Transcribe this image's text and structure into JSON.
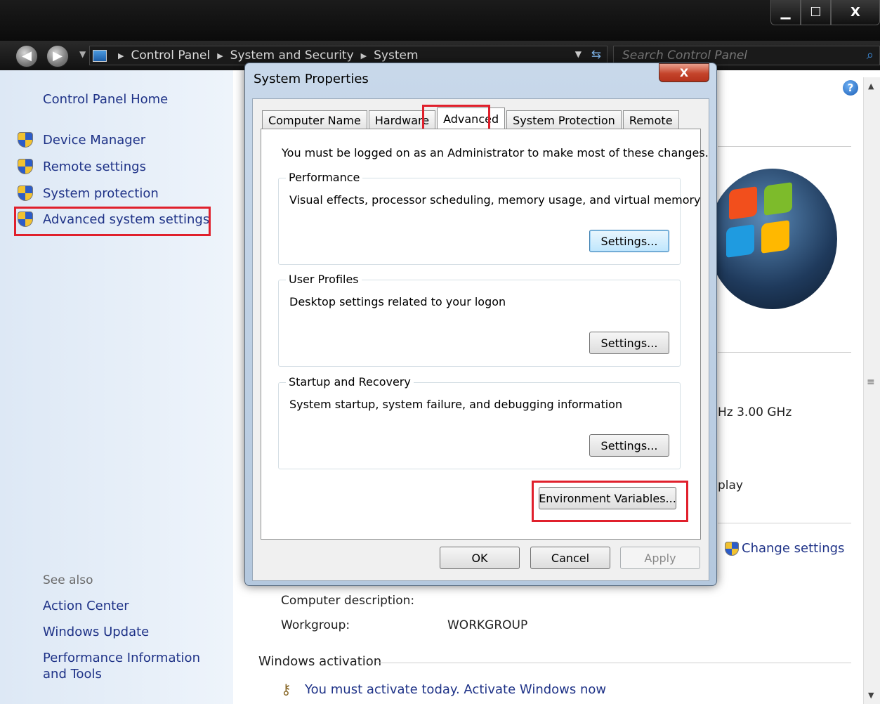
{
  "titlebar": {
    "minimize": "▁",
    "maximize": "☐",
    "close": "X"
  },
  "address": {
    "crumbs": [
      "Control Panel",
      "System and Security",
      "System"
    ],
    "search_placeholder": "Search Control Panel"
  },
  "leftpane": {
    "home": "Control Panel Home",
    "tasks": [
      "Device Manager",
      "Remote settings",
      "System protection",
      "Advanced system settings"
    ],
    "see_also_title": "See also",
    "see_also": [
      "Action Center",
      "Windows Update",
      "Performance Information and Tools"
    ]
  },
  "main": {
    "cpu_fragment": "Hz  3.00 GHz",
    "display_fragment": "play",
    "change_settings": "Change settings",
    "computer_description_label": "Computer description:",
    "workgroup_label": "Workgroup:",
    "workgroup_value": "WORKGROUP",
    "activation_title": "Windows activation",
    "activation_text": "You must activate today.  Activate Windows now"
  },
  "dialog": {
    "title": "System Properties",
    "close": "X",
    "tabs": [
      "Computer Name",
      "Hardware",
      "Advanced",
      "System Protection",
      "Remote"
    ],
    "active_tab": "Advanced",
    "admin_note": "You must be logged on as an Administrator to make most of these changes.",
    "groups": [
      {
        "label": "Performance",
        "desc": "Visual effects, processor scheduling, memory usage, and virtual memory",
        "button": "Settings..."
      },
      {
        "label": "User Profiles",
        "desc": "Desktop settings related to your logon",
        "button": "Settings..."
      },
      {
        "label": "Startup and Recovery",
        "desc": "System startup, system failure, and debugging information",
        "button": "Settings..."
      }
    ],
    "env_button": "Environment Variables...",
    "ok": "OK",
    "cancel": "Cancel",
    "apply": "Apply"
  },
  "colors": {
    "highlight": "#e0202c",
    "link": "#1e3287"
  }
}
